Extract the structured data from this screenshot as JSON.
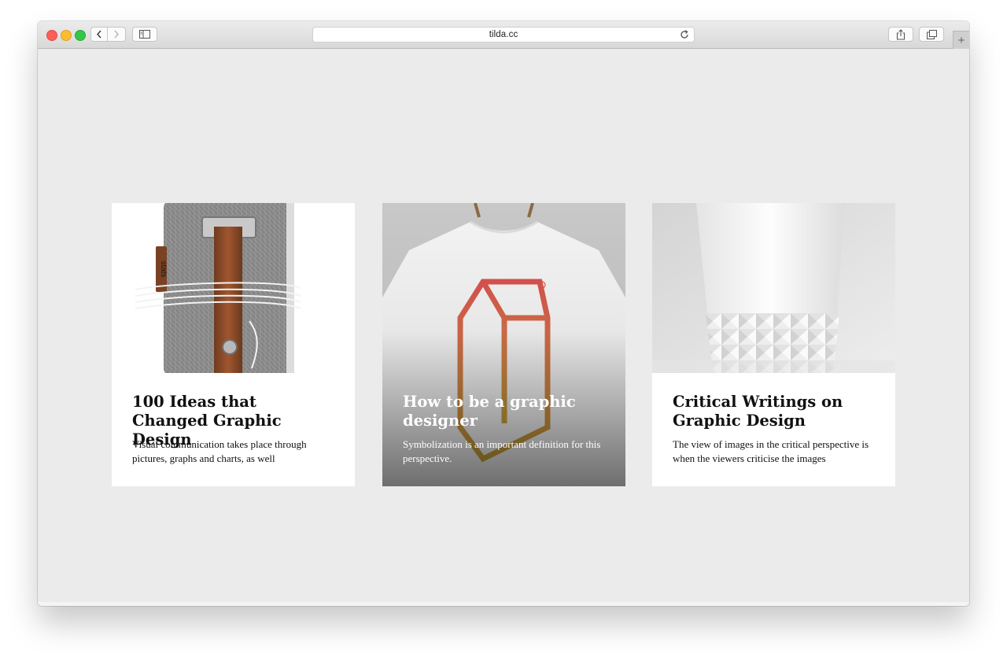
{
  "browser": {
    "url": "tilda.cc",
    "new_tab_label": "+"
  },
  "cards": [
    {
      "title": "100 Ideas that Changed Graphic Design",
      "description": "Visual communication takes place through pictures, graphs and charts, as well",
      "image_label": "stats"
    },
    {
      "title": "How to be a graphic designer",
      "description": "Symbolization is an important definition for this perspective."
    },
    {
      "title": "Critical Writings on Graphic Design",
      "description": "The view of images in the critical perspective is when the viewers criticise the images"
    }
  ],
  "colors": {
    "page_background": "#ebebeb",
    "card_background": "#ffffff",
    "text": "#111111",
    "logo_gradient_top": "#d9534f",
    "logo_gradient_bottom": "#c9a53a"
  }
}
